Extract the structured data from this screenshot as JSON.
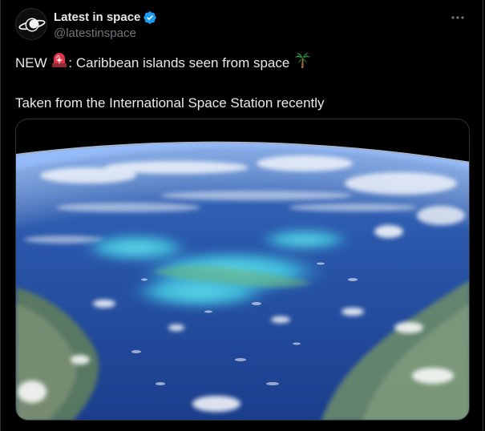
{
  "account": {
    "display_name": "Latest in space",
    "handle": "@latestinspace",
    "verified": true,
    "avatar_icon": "saturn-logo-icon"
  },
  "post": {
    "line1_prefix": "NEW ",
    "line1_emoji_1": "rotating-light-icon",
    "line1_text": ": Caribbean islands seen from space ",
    "line1_emoji_2": "palm-tree-icon",
    "line2_text": "Taken from the International Space Station recently"
  },
  "media": {
    "subject": "earth-photo-caribbean"
  },
  "colors": {
    "background": "#000000",
    "text": "#e7e9ea",
    "muted": "#71767b",
    "verified": "#1d9bf0",
    "border": "#2f3336"
  }
}
